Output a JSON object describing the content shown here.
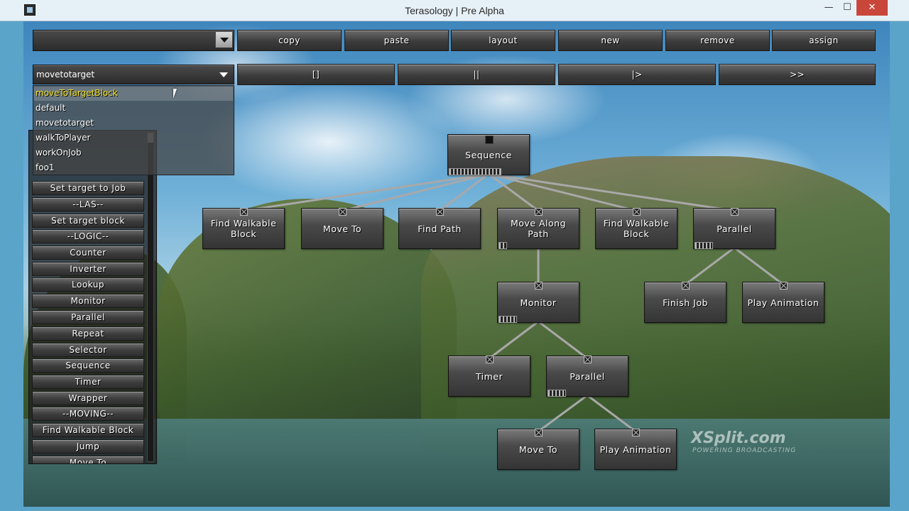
{
  "window": {
    "title": "Terasology | Pre Alpha",
    "min": "—",
    "max": "☐",
    "close": "✕"
  },
  "toolbar": {
    "tree_selector_value": "",
    "buttons": [
      "copy",
      "paste",
      "layout",
      "new",
      "remove",
      "assign"
    ]
  },
  "behavior_dropdown": {
    "value": "movetotarget",
    "options": [
      "moveToTargetBlock",
      "default",
      "movetotarget",
      "walkToPlayer",
      "workOnJob",
      "foo1"
    ],
    "selected_index": 0
  },
  "controls": {
    "stop": "[]",
    "pause": "||",
    "step": "|>",
    "fast_forward": ">>"
  },
  "palette": {
    "items": [
      "Set target to Job",
      "--LAS--",
      "Set target block",
      "--LOGIC--",
      "Counter",
      "Inverter",
      "Lookup",
      "Monitor",
      "Parallel",
      "Repeat",
      "Selector",
      "Sequence",
      "Timer",
      "Wrapper",
      "--MOVING--",
      "Find Walkable Block",
      "Jump",
      "Move To"
    ]
  },
  "graph": {
    "nodes": [
      {
        "id": "sequence",
        "label": "Sequence"
      },
      {
        "id": "find-walkable-1",
        "label": "Find Walkable Block"
      },
      {
        "id": "move-to-1",
        "label": "Move To"
      },
      {
        "id": "find-path",
        "label": "Find Path"
      },
      {
        "id": "move-along-path",
        "label": "Move Along Path"
      },
      {
        "id": "find-walkable-2",
        "label": "Find Walkable Block"
      },
      {
        "id": "parallel-1",
        "label": "Parallel"
      },
      {
        "id": "monitor",
        "label": "Monitor"
      },
      {
        "id": "finish-job",
        "label": "Finish Job"
      },
      {
        "id": "play-animation-1",
        "label": "Play Animation"
      },
      {
        "id": "timer",
        "label": "Timer"
      },
      {
        "id": "parallel-2",
        "label": "Parallel"
      },
      {
        "id": "move-to-2",
        "label": "Move To"
      },
      {
        "id": "play-animation-2",
        "label": "Play Animation"
      }
    ],
    "edges": [
      [
        "sequence",
        "find-walkable-1"
      ],
      [
        "sequence",
        "move-to-1"
      ],
      [
        "sequence",
        "find-path"
      ],
      [
        "sequence",
        "move-along-path"
      ],
      [
        "sequence",
        "find-walkable-2"
      ],
      [
        "sequence",
        "parallel-1"
      ],
      [
        "move-along-path",
        "monitor"
      ],
      [
        "parallel-1",
        "finish-job"
      ],
      [
        "parallel-1",
        "play-animation-1"
      ],
      [
        "monitor",
        "timer"
      ],
      [
        "monitor",
        "parallel-2"
      ],
      [
        "parallel-2",
        "move-to-2"
      ],
      [
        "parallel-2",
        "play-animation-2"
      ]
    ]
  },
  "watermark": {
    "brand": "XSplit.com",
    "tagline": "POWERING BROADCASTING"
  }
}
